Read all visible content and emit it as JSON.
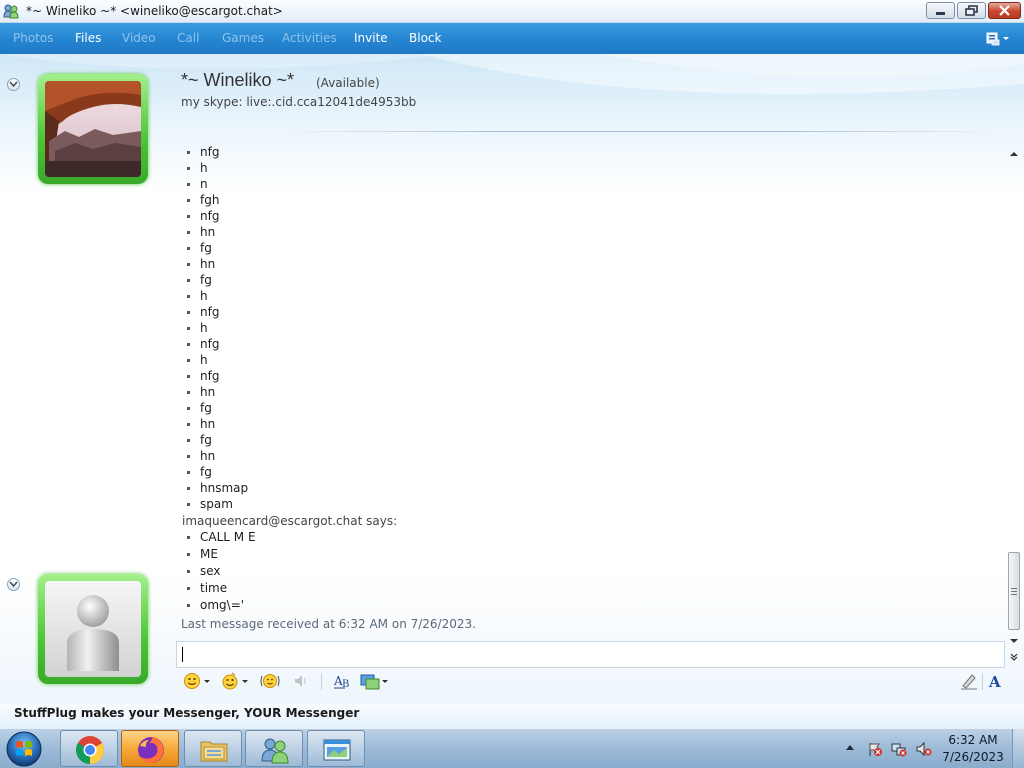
{
  "window": {
    "title": "*~ Wineliko ~* <wineliko@escargot.chat>"
  },
  "menu": {
    "items": [
      {
        "label": "Photos",
        "enabled": false
      },
      {
        "label": "Files",
        "enabled": true
      },
      {
        "label": "Video",
        "enabled": false
      },
      {
        "label": "Call",
        "enabled": false
      },
      {
        "label": "Games",
        "enabled": false
      },
      {
        "label": "Activities",
        "enabled": false
      },
      {
        "label": "Invite",
        "enabled": true
      },
      {
        "label": "Block",
        "enabled": true
      }
    ]
  },
  "contact": {
    "name": "*~ Wineliko ~*",
    "status": "(Available)",
    "personal_message": "my skype: live:.cid.cca12041de4953bb"
  },
  "conversation": {
    "first_block": [
      "nfg",
      "h",
      "n",
      "fgh",
      "nfg",
      "hn",
      "fg",
      "hn",
      "fg",
      "h",
      "nfg",
      "h",
      "nfg",
      "h",
      "nfg",
      "hn",
      "fg",
      "hn",
      "fg",
      "hn",
      "fg",
      "hnsmap",
      "spam"
    ],
    "sender": "imaqueencard@escargot.chat says:",
    "second_block": [
      "CALL M E",
      "ME",
      "sex",
      "time",
      "omg\\='"
    ],
    "last_received": "Last message received at 6:32 AM on 7/26/2023."
  },
  "input": {
    "value": ""
  },
  "toolbar": {
    "icons": [
      "emoticon-icon",
      "wink-icon",
      "nudge-icon",
      "voice-clip-icon",
      "font-icon",
      "background-icon",
      "handwriting-icon",
      "text-format-icon"
    ]
  },
  "footer": {
    "ad_text": "StuffPlug makes your Messenger, YOUR Messenger"
  },
  "taskbar": {
    "apps": [
      "Google Chrome",
      "Firefox",
      "Windows Explorer",
      "Windows Live Messenger",
      "Conversation window"
    ],
    "time": "6:32 AM",
    "date": "7/26/2023"
  },
  "colors": {
    "menubar": "#2686d2",
    "avatar_frame": "#4cc536",
    "link_text": "#1e1e1e"
  }
}
